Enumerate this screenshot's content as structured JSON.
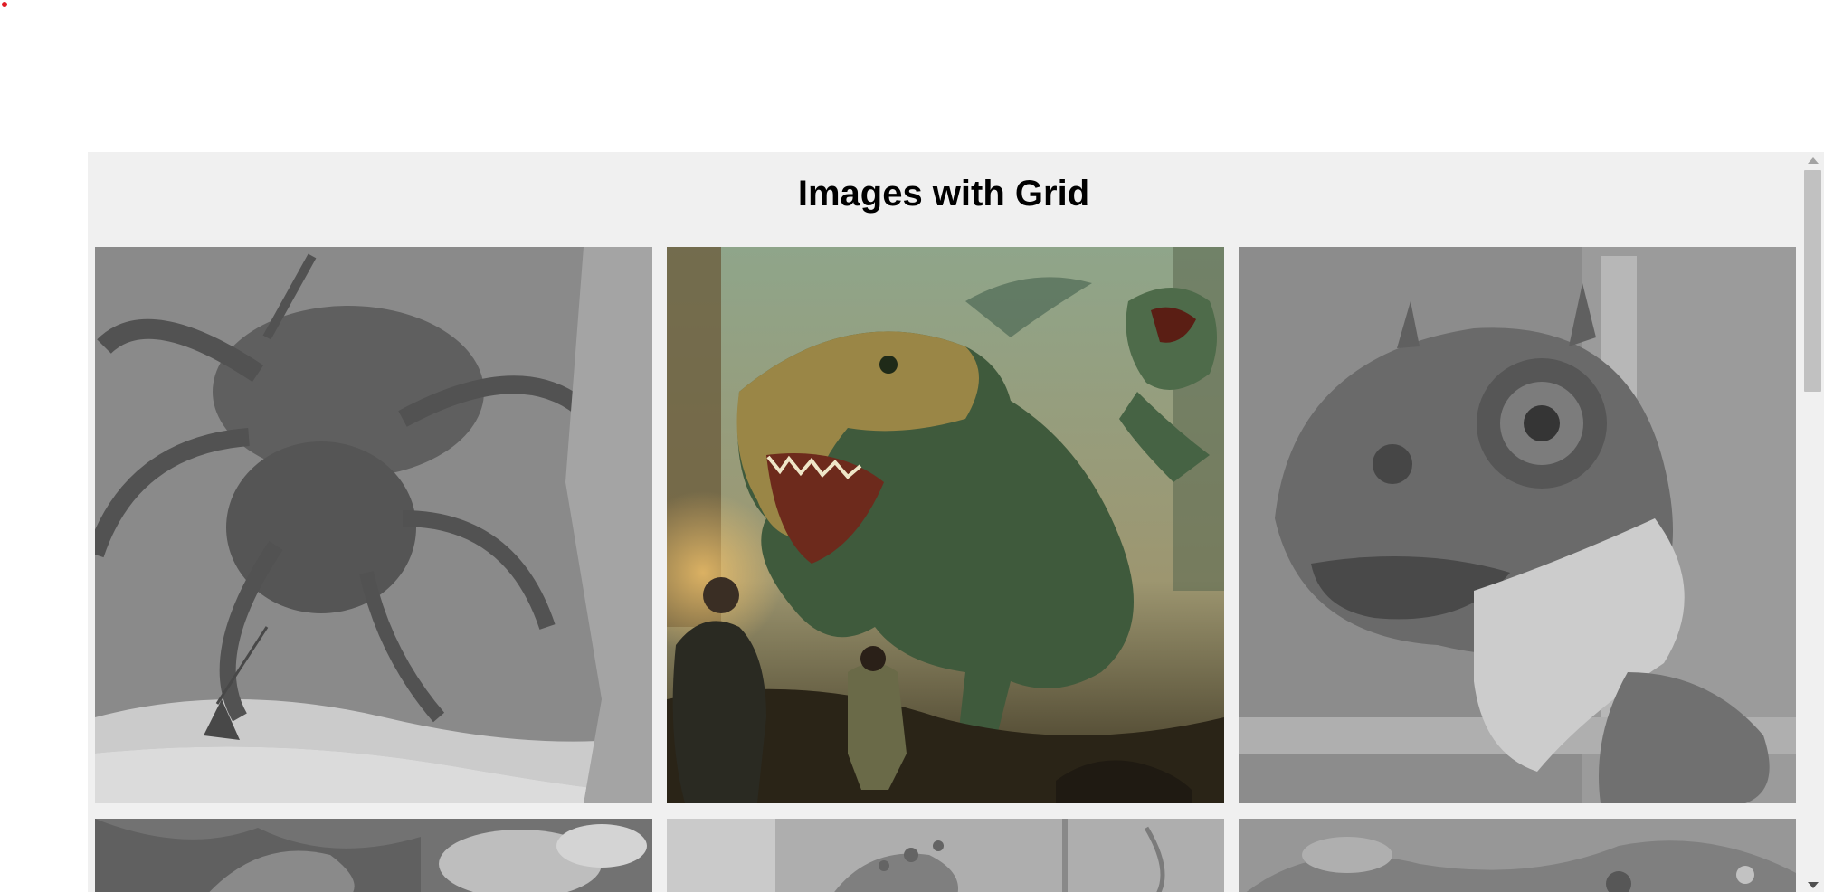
{
  "page": {
    "title": "Images with Grid",
    "indicator_color": "#e01b24",
    "frame_bg": "#f0f0f0"
  },
  "images": [
    {
      "name": "spider-monster-image",
      "highlighted": false
    },
    {
      "name": "dinosaur-attack-image",
      "highlighted": true
    },
    {
      "name": "chameleon-portrait-image",
      "highlighted": false
    },
    {
      "name": "jungle-foliage-image",
      "highlighted": false
    },
    {
      "name": "plant-creature-image",
      "highlighted": false
    },
    {
      "name": "mushroom-garden-image",
      "highlighted": false
    }
  ],
  "scrollbar": {
    "icons": [
      "scroll-up-arrow-icon",
      "scroll-down-arrow-icon"
    ]
  }
}
